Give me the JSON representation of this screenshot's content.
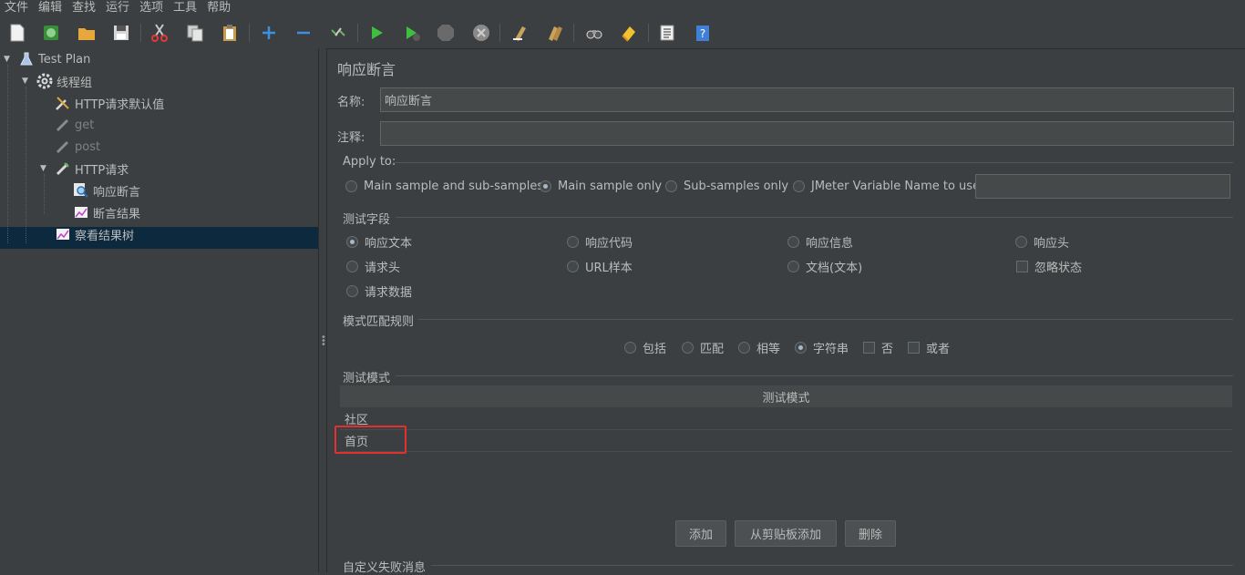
{
  "menu": [
    "文件",
    "编辑",
    "查找",
    "运行",
    "选项",
    "工具",
    "帮助"
  ],
  "tree": {
    "items": [
      {
        "label": "Test Plan",
        "icon": "flask-icon"
      },
      {
        "label": "线程组",
        "icon": "gear-icon"
      },
      {
        "label": "HTTP请求默认值",
        "icon": "wrench-icon"
      },
      {
        "label": "get",
        "icon": "pipette-icon"
      },
      {
        "label": "post",
        "icon": "pipette-icon"
      },
      {
        "label": "HTTP请求",
        "icon": "pipette-icon"
      },
      {
        "label": "响应断言",
        "icon": "magnifier-icon"
      },
      {
        "label": "断言结果",
        "icon": "graph-icon"
      },
      {
        "label": "察看结果树",
        "icon": "graph-icon"
      }
    ]
  },
  "panel": {
    "title": "响应断言",
    "name_label": "名称:",
    "name_value": "响应断言",
    "comment_label": "注释:",
    "comment_value": "",
    "apply_to": {
      "title": "Apply to:",
      "options": [
        "Main sample and sub-samples",
        "Main sample only",
        "Sub-samples only",
        "JMeter Variable Name to use"
      ],
      "selected": "Main sample only",
      "variable_value": ""
    },
    "test_field": {
      "title": "测试字段",
      "options": [
        "响应文本",
        "响应代码",
        "响应信息",
        "响应头",
        "请求头",
        "URL样本",
        "文档(文本)",
        "忽略状态",
        "请求数据"
      ],
      "selected": "响应文本"
    },
    "pattern_rules": {
      "title": "模式匹配规则",
      "options": [
        "包括",
        "匹配",
        "相等",
        "字符串",
        "否",
        "或者"
      ],
      "selected": "字符串"
    },
    "patterns": {
      "title": "测试模式",
      "column": "测试模式",
      "rows": [
        "社区",
        "首页"
      ]
    },
    "buttons": {
      "add": "添加",
      "paste": "从剪贴板添加",
      "delete": "删除"
    },
    "custom_fail_title": "自定义失败消息"
  },
  "colors": {
    "background": "#3c3f41",
    "selection": "#0d293e",
    "highlight": "#e03030"
  }
}
